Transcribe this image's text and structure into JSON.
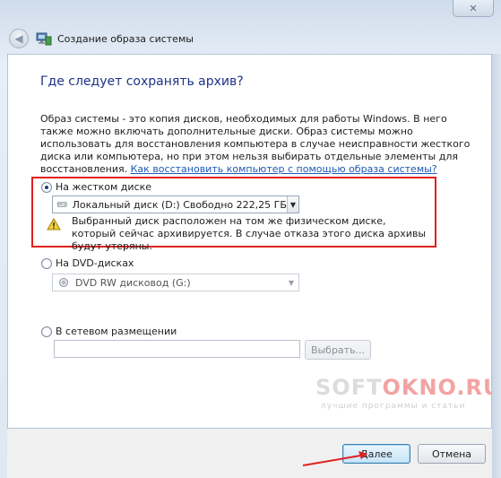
{
  "window": {
    "title": "Создание образа системы",
    "close_label": "✕"
  },
  "page": {
    "heading": "Где следует сохранять архив?",
    "description": "Образ системы - это копия дисков, необходимых для работы Windows. В него также можно включать дополнительные диски. Образ системы можно использовать для восстановления компьютера в случае неисправности жесткого диска или компьютера, но при этом нельзя выбирать отдельные элементы для восстановления.",
    "help_link": "Как восстановить компьютер с помощью образа системы?"
  },
  "options": {
    "hard_disk": {
      "label": "На жестком диске",
      "selected": true,
      "drive_value": "Локальный диск (D:)  Свободно 222,25 ГБ",
      "warning": "Выбранный диск расположен на том же физическом диске, который сейчас архивируется. В случае отказа этого диска архивы будут утеряны."
    },
    "dvd": {
      "label": "На DVD-дисках",
      "selected": false,
      "drive_value": "DVD RW дисковод (G:)"
    },
    "network": {
      "label": "В сетевом размещении",
      "selected": false,
      "path_value": "",
      "browse_label": "Выбрать..."
    }
  },
  "footer": {
    "next_label": "Далее",
    "cancel_label": "Отмена"
  },
  "watermark": {
    "brand_prefix": "SOFT",
    "brand_suffix": "OKNO.RU",
    "tagline": "лучшие программы и статьи"
  },
  "colors": {
    "heading": "#1e3287",
    "link": "#1e5ab4",
    "highlight": "#e02020"
  }
}
